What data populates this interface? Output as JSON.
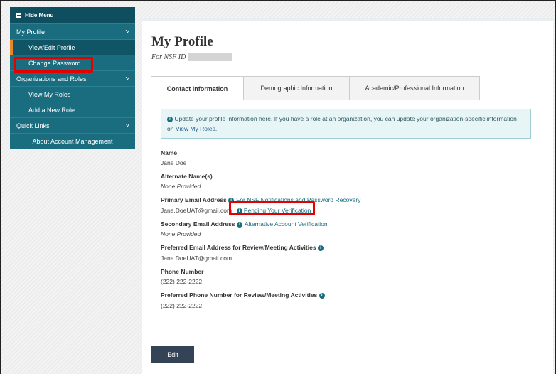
{
  "sidebar": {
    "hide_menu": "Hide Menu",
    "sections": {
      "my_profile": "My Profile",
      "organizations": "Organizations and Roles",
      "quick_links": "Quick Links"
    },
    "items": {
      "view_edit_profile": "View/Edit Profile",
      "change_password": "Change Password",
      "view_my_roles": "View My Roles",
      "add_new_role": "Add a New Role",
      "about_account": "About Account Management"
    },
    "colors": {
      "bg": "#1a6c7f",
      "active": "#105566",
      "accent": "#e8862a"
    }
  },
  "header": {
    "title": "My Profile",
    "subtitle": "For NSF ID"
  },
  "tabs": [
    {
      "label": "Contact Information",
      "active": true
    },
    {
      "label": "Demographic Information",
      "active": false
    },
    {
      "label": "Academic/Professional Information",
      "active": false
    }
  ],
  "info": {
    "text": "Update your profile information here. If you have a role at an organization, you can update your organization-specific information on",
    "link": "View My Roles",
    "end": "."
  },
  "fields": {
    "name_label": "Name",
    "name_value": "Jane Doe",
    "alt_label": "Alternate Name(s)",
    "alt_value": "None Provided",
    "primary_label": "Primary Email Address",
    "primary_hint": "For NSF Notifications and Password Recovery",
    "primary_value": "Jane.DoeUAT@gmail.com",
    "pending": "Pending Your Verification",
    "secondary_label": "Secondary Email Address",
    "secondary_hint": "Alternative Account Verification",
    "secondary_value": "None Provided",
    "pref_email_label": "Preferred Email Address for Review/Meeting Activities",
    "pref_email_value": "Jane.DoeUAT@gmail.com",
    "phone_label": "Phone Number",
    "phone_value": "(222) 222-2222",
    "pref_phone_label": "Preferred Phone Number for Review/Meeting Activities",
    "pref_phone_value": "(222) 222-2222"
  },
  "actions": {
    "edit": "Edit"
  },
  "highlight_color": "#e50000"
}
